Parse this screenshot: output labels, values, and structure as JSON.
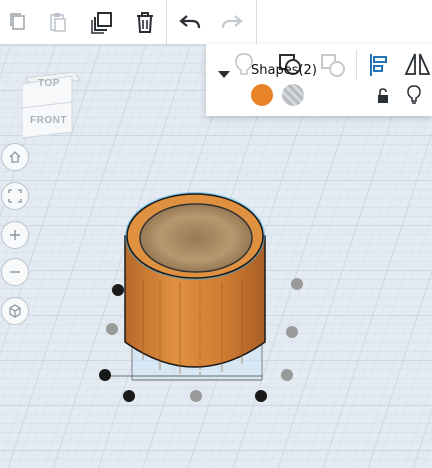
{
  "toolbar": {
    "items": [
      "copy",
      "paste",
      "duplicate",
      "delete",
      "undo",
      "redo"
    ]
  },
  "view_cube": {
    "top_label": "TOP",
    "front_label": "FRONT"
  },
  "inspector": {
    "title": "Shapes(2)",
    "solid_color": "#e8832a",
    "hole_color": "#b8bcc0"
  },
  "nav_controls": [
    "home",
    "fit",
    "zoom-in",
    "zoom-out",
    "perspective"
  ],
  "scene": {
    "object": "cylinder",
    "object_color": "#d98840"
  }
}
